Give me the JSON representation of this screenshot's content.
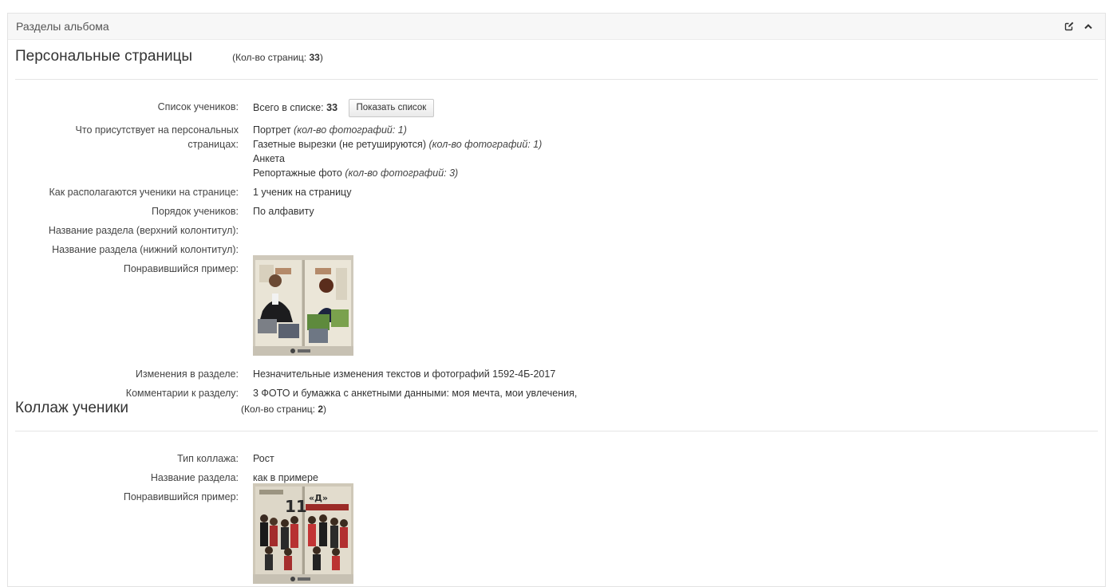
{
  "panel": {
    "title": "Разделы альбома",
    "tools": {
      "edit_icon": "edit-icon",
      "collapse_icon": "chevron-up-icon"
    }
  },
  "section1": {
    "title": "Персональные страницы",
    "count_prefix": "(Кол-во страниц: ",
    "count_value": "33",
    "count_suffix": ")",
    "rows": {
      "students_label": "Список учеников:",
      "students_total_prefix": "Всего в списке: ",
      "students_total_value": "33",
      "show_list_button": "Показать список",
      "contents_label_1": "Что присутствует на персональных",
      "contents_label_2": "страницах:",
      "contents": [
        {
          "name": "Портрет",
          "note": "(кол-во фотографий: 1)"
        },
        {
          "name": "Газетные вырезки (не ретушируются)",
          "note": "(кол-во фотографий: 1)"
        },
        {
          "name": "Анкета",
          "note": ""
        },
        {
          "name": "Репортажные фото",
          "note": "(кол-во фотографий: 3)"
        }
      ],
      "layout_label": "Как располагаются ученики на странице:",
      "layout_value": "1 ученик на страницу",
      "order_label": "Порядок учеников:",
      "order_value": "По алфавиту",
      "header_label": "Название раздела (верхний колонтитул):",
      "footer_label": "Название раздела (нижний колонтитул):",
      "example_label": "Понравившийся пример:",
      "changes_label": "Изменения в разделе:",
      "changes_value": "Незначительные изменения текстов и фотографий 1592-4Б-2017",
      "comments_label": "Комментарии к разделу:",
      "comments_value": "3 ФОТО и бумажка с анкетными данными: моя мечта, мои увлечения,"
    }
  },
  "section2": {
    "title": "Коллаж ученики",
    "count_prefix": "(Кол-во страниц: ",
    "count_value": "2",
    "count_suffix": ")",
    "rows": {
      "type_label": "Тип коллажа:",
      "type_value": "Рост",
      "name_label": "Название раздела:",
      "name_value": "как в примере",
      "example_label": "Понравившийся пример:"
    }
  },
  "colors": {
    "border": "#e3e3e3",
    "header_bg": "#f7f7f7",
    "text": "#333333"
  }
}
